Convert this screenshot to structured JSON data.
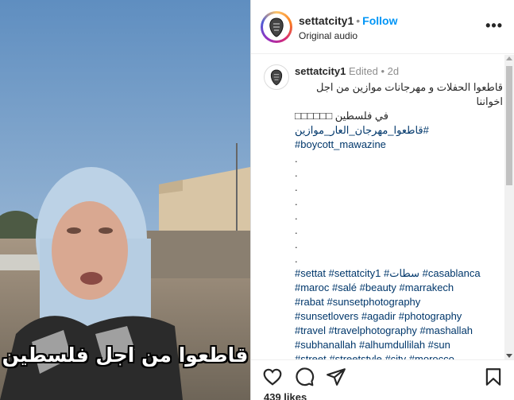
{
  "media": {
    "overlay_text": "قاطعوا من اجل فلسطين"
  },
  "header": {
    "username": "settatcity1",
    "separator": "•",
    "follow_label": "Follow",
    "audio": "Original audio",
    "more_icon": "more-horizontal-icon"
  },
  "comment": {
    "username": "settatcity1",
    "edited": "Edited",
    "separator": "•",
    "time": "2d",
    "line1": "قاطعوا الحفلات و مهرجانات موازين من اجل اخواننا",
    "line2": "في فلسطين □□□□□□",
    "tag1": "#قاطعوا_مهرجان_العار_موازين",
    "tag2": "#boycott_mawazine",
    "dots": [
      ".",
      ".",
      ".",
      ".",
      ".",
      ".",
      ".",
      "."
    ],
    "hashtag_lines": [
      "#settat #settatcity1 #سطات #casablanca",
      "#maroc #salé #beauty #marrakech",
      "#rabat #sunsetphotography",
      "#sunsetlovers #agadir #photography",
      "#travel #travelphotography #mashallah",
      "#subhanallah #alhumdullilah #sun",
      "#street #streetstyle #city #morocco"
    ]
  },
  "actions": {
    "like_icon": "heart-icon",
    "comment_icon": "comment-icon",
    "share_icon": "share-icon",
    "save_icon": "bookmark-icon"
  },
  "likes": "439 likes",
  "colors": {
    "link": "#0095f6",
    "hashtag": "#00376b",
    "muted": "#8e8e8e"
  }
}
